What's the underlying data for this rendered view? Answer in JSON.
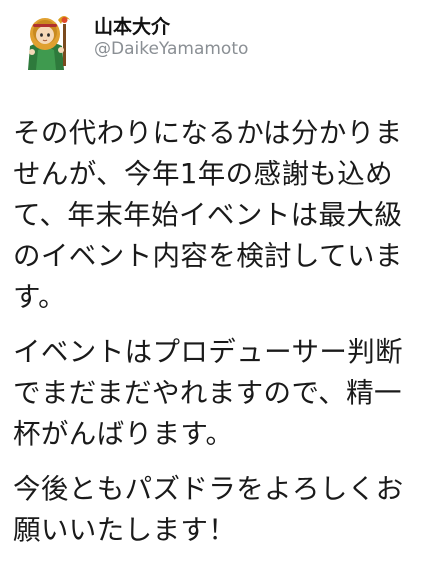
{
  "tweet": {
    "author": {
      "name": "山本大介",
      "handle": "@DaikeYamamoto"
    },
    "paragraphs": [
      {
        "lines": [
          "その代わりになるかは分かりま",
          "せんが、今年1年の感謝も込め",
          "て、年末年始イベントは最大級",
          "のイベント内容を検討していま",
          "す。"
        ]
      },
      {
        "lines": [
          "イベントはプロデューサー判断",
          "でまだまだやれますので、精一",
          "杯がんばります。"
        ]
      },
      {
        "lines": [
          "今後ともパズドラをよろしくお",
          "願いいたします！"
        ]
      }
    ]
  }
}
